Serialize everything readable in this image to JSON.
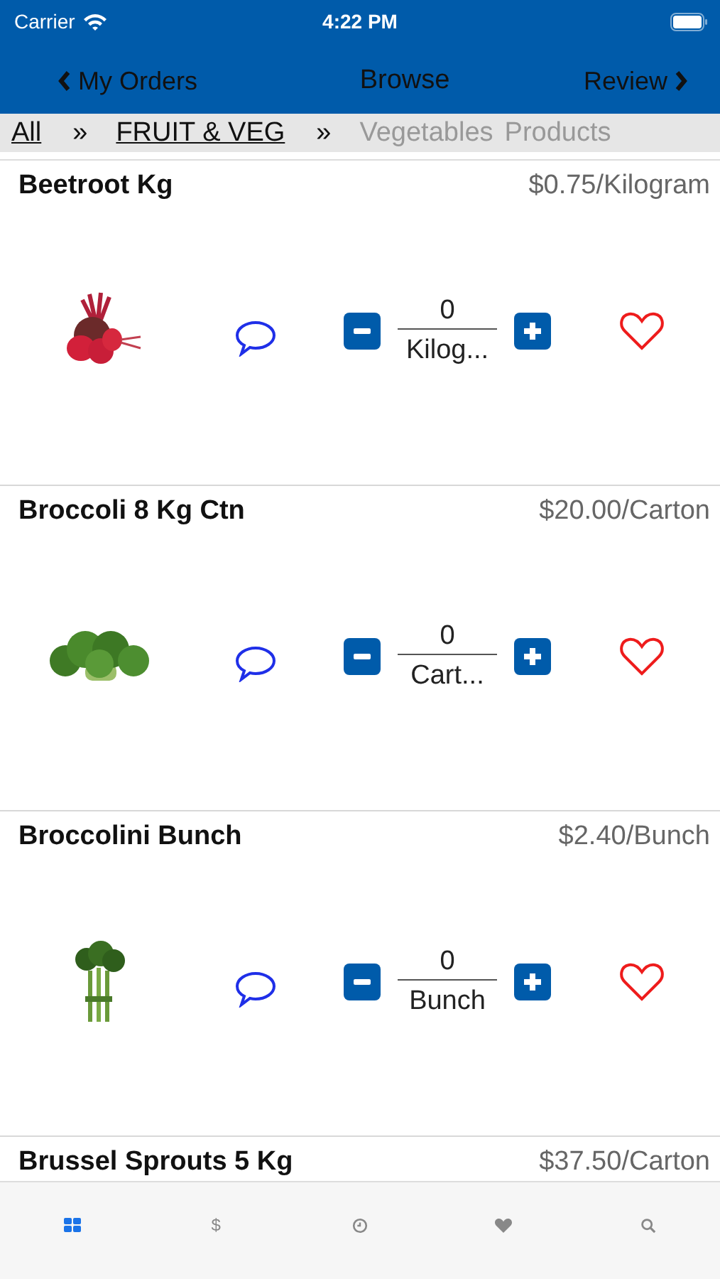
{
  "status_bar": {
    "carrier": "Carrier",
    "time": "4:22 PM"
  },
  "nav": {
    "back": "My Orders",
    "title": "Browse",
    "forward": "Review"
  },
  "breadcrumb": [
    {
      "label": "All",
      "kind": "link"
    },
    {
      "label": "»",
      "kind": "separator"
    },
    {
      "label": "FRUIT & VEG",
      "kind": "link"
    },
    {
      "label": "»",
      "kind": "separator"
    },
    {
      "label": "Vegetables",
      "kind": "current"
    },
    {
      "label": "Products",
      "kind": "current"
    }
  ],
  "products": [
    {
      "name": "Beetroot Kg",
      "price": "$0.75/Kilogram",
      "quantity": "0",
      "unit": "Kilog...",
      "favorite": false
    },
    {
      "name": "Broccoli 8 Kg Ctn",
      "price": "$20.00/Carton",
      "quantity": "0",
      "unit": "Cart...",
      "favorite": false
    },
    {
      "name": "Broccolini Bunch",
      "price": "$2.40/Bunch",
      "quantity": "0",
      "unit": "Bunch",
      "favorite": false
    },
    {
      "name": "Brussel Sprouts 5 Kg",
      "price": "$37.50/Carton"
    }
  ],
  "tab_bar": [
    {
      "kind": "grid",
      "selected": true
    },
    {
      "kind": "dollar",
      "glyph": "$",
      "selected": false
    },
    {
      "kind": "clock",
      "selected": false
    },
    {
      "kind": "heart",
      "selected": false
    },
    {
      "kind": "search",
      "selected": false
    }
  ]
}
